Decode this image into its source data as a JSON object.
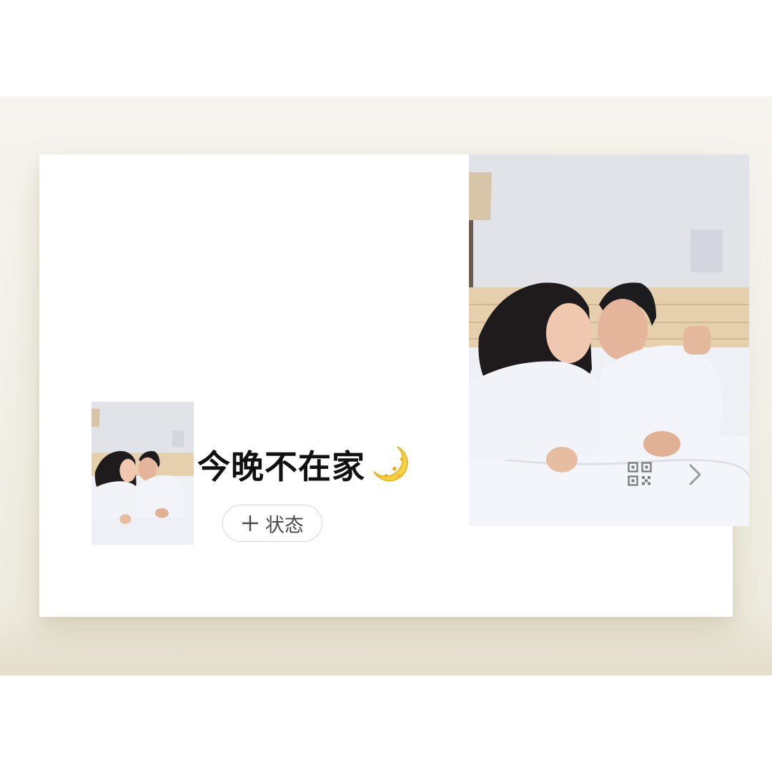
{
  "profile": {
    "nickname": "今晚不在家",
    "status_button_label": "状态"
  },
  "icons": {
    "nickname_emoji": "crescent-moon-icon",
    "status_add": "plus-icon",
    "qr_code": "qr-code-icon",
    "navigate": "chevron-right-icon"
  },
  "colors": {
    "backdrop": "#f3f1ea",
    "card": "#ffffff",
    "text": "#111111",
    "icon_gray": "#8a8a8a"
  }
}
